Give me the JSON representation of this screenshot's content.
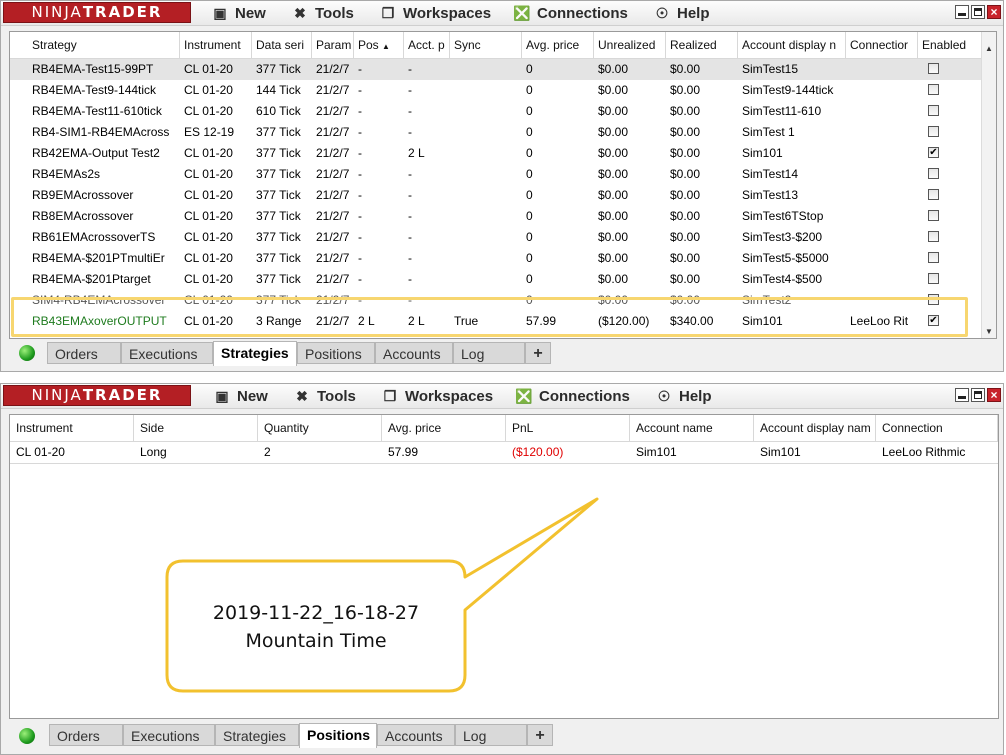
{
  "brand": {
    "part1": "NINJA",
    "part2": "TRADER"
  },
  "menu": [
    {
      "label": "New",
      "icon": "new-window-icon"
    },
    {
      "label": "Tools",
      "icon": "tools-icon"
    },
    {
      "label": "Workspaces",
      "icon": "workspaces-icon"
    },
    {
      "label": "Connections",
      "icon": "connections-plug-icon"
    },
    {
      "label": "Help",
      "icon": "help-lifebuoy-icon"
    }
  ],
  "strategies": {
    "columns": [
      "Strategy",
      "Instrument",
      "Data seri",
      "Param",
      "Pos",
      "Acct. p",
      "Sync",
      "Avg. price",
      "Unrealized",
      "Realized",
      "Account display n",
      "Connectior",
      "Enabled"
    ],
    "sort_indicator": "▲",
    "rows": [
      {
        "strategy": "RB4EMA-Test15-99PT",
        "instrument": "CL 01-20",
        "data": "377 Tick",
        "param": "21/2/7",
        "pos": "-",
        "acct": "-",
        "sync": "",
        "avg": "0",
        "unrealized": "$0.00",
        "realized": "$0.00",
        "account": "SimTest15",
        "connection": "",
        "enabled": false
      },
      {
        "strategy": "RB4EMA-Test9-144tick",
        "instrument": "CL 01-20",
        "data": "144 Tick",
        "param": "21/2/7",
        "pos": "-",
        "acct": "-",
        "sync": "",
        "avg": "0",
        "unrealized": "$0.00",
        "realized": "$0.00",
        "account": "SimTest9-144tick",
        "connection": "",
        "enabled": false
      },
      {
        "strategy": "RB4EMA-Test11-610tick",
        "instrument": "CL 01-20",
        "data": "610 Tick",
        "param": "21/2/7",
        "pos": "-",
        "acct": "-",
        "sync": "",
        "avg": "0",
        "unrealized": "$0.00",
        "realized": "$0.00",
        "account": "SimTest11-610",
        "connection": "",
        "enabled": false
      },
      {
        "strategy": "RB4-SIM1-RB4EMAcross",
        "instrument": "ES 12-19",
        "data": "377 Tick",
        "param": "21/2/7",
        "pos": "-",
        "acct": "-",
        "sync": "",
        "avg": "0",
        "unrealized": "$0.00",
        "realized": "$0.00",
        "account": "SimTest 1",
        "connection": "",
        "enabled": false
      },
      {
        "strategy": "RB42EMA-Output Test2",
        "instrument": "CL 01-20",
        "data": "377 Tick",
        "param": "21/2/7",
        "pos": "-",
        "acct": "2 L",
        "sync": "",
        "avg": "0",
        "unrealized": "$0.00",
        "realized": "$0.00",
        "account": "Sim101",
        "connection": "",
        "enabled": true
      },
      {
        "strategy": "RB4EMAs2s",
        "instrument": "CL 01-20",
        "data": "377 Tick",
        "param": "21/2/7",
        "pos": "-",
        "acct": "-",
        "sync": "",
        "avg": "0",
        "unrealized": "$0.00",
        "realized": "$0.00",
        "account": "SimTest14",
        "connection": "",
        "enabled": false
      },
      {
        "strategy": "RB9EMAcrossover",
        "instrument": "CL 01-20",
        "data": "377 Tick",
        "param": "21/2/7",
        "pos": "-",
        "acct": "-",
        "sync": "",
        "avg": "0",
        "unrealized": "$0.00",
        "realized": "$0.00",
        "account": "SimTest13",
        "connection": "",
        "enabled": false
      },
      {
        "strategy": "RB8EMAcrossover",
        "instrument": "CL 01-20",
        "data": "377 Tick",
        "param": "21/2/7",
        "pos": "-",
        "acct": "-",
        "sync": "",
        "avg": "0",
        "unrealized": "$0.00",
        "realized": "$0.00",
        "account": "SimTest6TStop",
        "connection": "",
        "enabled": false
      },
      {
        "strategy": "RB61EMAcrossoverTS",
        "instrument": "CL 01-20",
        "data": "377 Tick",
        "param": "21/2/7",
        "pos": "-",
        "acct": "-",
        "sync": "",
        "avg": "0",
        "unrealized": "$0.00",
        "realized": "$0.00",
        "account": "SimTest3-$200",
        "connection": "",
        "enabled": false
      },
      {
        "strategy": "RB4EMA-$201PTmultiEr",
        "instrument": "CL 01-20",
        "data": "377 Tick",
        "param": "21/2/7",
        "pos": "-",
        "acct": "-",
        "sync": "",
        "avg": "0",
        "unrealized": "$0.00",
        "realized": "$0.00",
        "account": "SimTest5-$5000",
        "connection": "",
        "enabled": false
      },
      {
        "strategy": "RB4EMA-$201Ptarget",
        "instrument": "CL 01-20",
        "data": "377 Tick",
        "param": "21/2/7",
        "pos": "-",
        "acct": "-",
        "sync": "",
        "avg": "0",
        "unrealized": "$0.00",
        "realized": "$0.00",
        "account": "SimTest4-$500",
        "connection": "",
        "enabled": false
      },
      {
        "strategy": "SIM4-RB4EMAcrossover",
        "instrument": "CL 01-20",
        "data": "377 Tick",
        "param": "21/2/7",
        "pos": "-",
        "acct": "-",
        "sync": "",
        "avg": "0",
        "unrealized": "$0.00",
        "realized": "$0.00",
        "account": "SimTest2",
        "connection": "",
        "enabled": false
      },
      {
        "strategy": "RB43EMAxoverOUTPUT",
        "instrument": "CL 01-20",
        "data": "3 Range",
        "param": "21/2/7",
        "pos": "2 L",
        "acct": "2 L",
        "sync": "True",
        "avg": "57.99",
        "unrealized": "($120.00)",
        "realized": "$340.00",
        "account": "Sim101",
        "connection": "LeeLoo Rit",
        "enabled": true
      }
    ]
  },
  "positions": {
    "columns": [
      "Instrument",
      "Side",
      "Quantity",
      "Avg. price",
      "PnL",
      "Account name",
      "Account display nam",
      "Connection"
    ],
    "rows": [
      {
        "instrument": "CL 01-20",
        "side": "Long",
        "quantity": "2",
        "avg": "57.99",
        "pnl": "($120.00)",
        "account": "Sim101",
        "display": "Sim101",
        "connection": "LeeLoo Rithmic"
      }
    ]
  },
  "tabs": [
    "Orders",
    "Executions",
    "Strategies",
    "Positions",
    "Accounts",
    "Log"
  ],
  "tabs_plus": "+",
  "active_tab_top": "Strategies",
  "active_tab_bottom": "Positions",
  "callout": {
    "line1": "2019-11-22_16-18-27",
    "line2": "Mountain Time"
  },
  "colors": {
    "brand": "#b41f24",
    "highlight": "#f7d670",
    "negative": "#e00000",
    "green_text": "#1e7b1e"
  }
}
